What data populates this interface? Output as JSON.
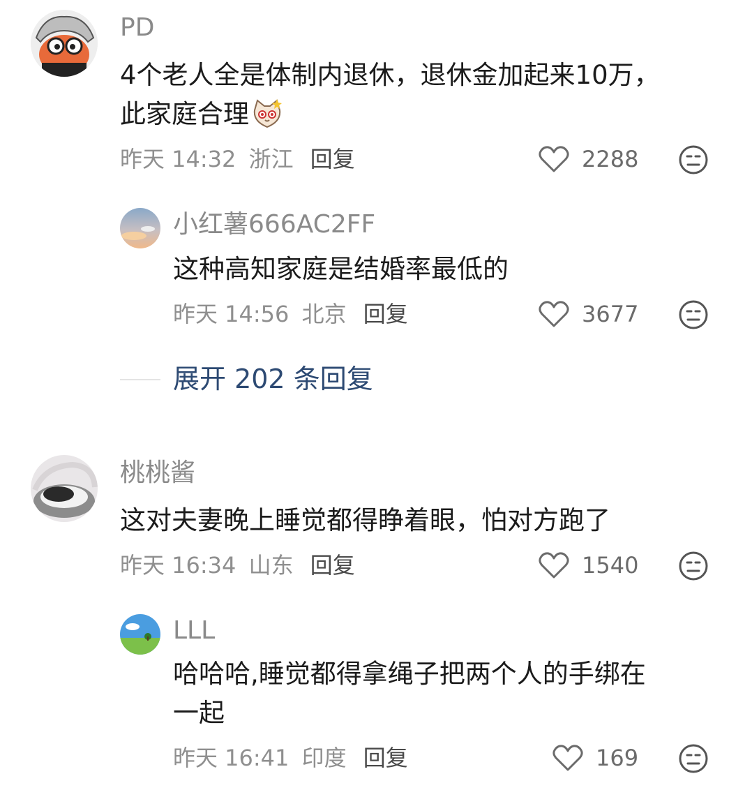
{
  "comments": [
    {
      "username": "PD",
      "text_line1": "4个老人全是体制内退休，退休金加起来10万，",
      "text_line2": "此家庭合理",
      "time": "昨天 14:32",
      "location": "浙江",
      "reply_label": "回复",
      "likes": "2288",
      "replies": [
        {
          "username": "小红薯666AC2FF",
          "text": "这种高知家庭是结婚率最低的",
          "time": "昨天 14:56",
          "location": "北京",
          "reply_label": "回复",
          "likes": "3677"
        }
      ],
      "expand_label": "展开 202 条回复"
    },
    {
      "username": "桃桃酱",
      "text": "这对夫妻晚上睡觉都得睁着眼，怕对方跑了",
      "time": "昨天 16:34",
      "location": "山东",
      "reply_label": "回复",
      "likes": "1540",
      "replies": [
        {
          "username": "LLL",
          "text_line1": "哈哈哈,睡觉都得拿绳子把两个人的手绑在",
          "text_line2": "一起",
          "time": "昨天 16:41",
          "location": "印度",
          "reply_label": "回复",
          "likes": "169"
        }
      ]
    }
  ],
  "icons": {
    "like": "heart-outline-icon",
    "reaction": "neutral-face-icon",
    "inline_emoji": "cat-emoji-icon"
  },
  "colors": {
    "username": "#8a8a8a",
    "text": "#1b1b1b",
    "meta": "#8f8f8f",
    "expand": "#2d4a73"
  }
}
